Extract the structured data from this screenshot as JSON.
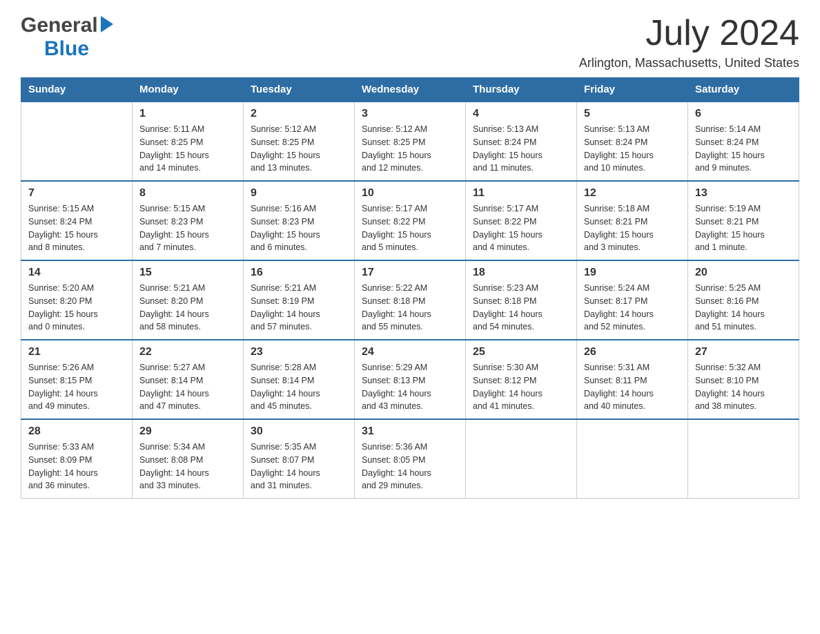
{
  "header": {
    "logo_general": "General",
    "logo_blue": "Blue",
    "month_year": "July 2024",
    "location": "Arlington, Massachusetts, United States"
  },
  "calendar": {
    "days_of_week": [
      "Sunday",
      "Monday",
      "Tuesday",
      "Wednesday",
      "Thursday",
      "Friday",
      "Saturday"
    ],
    "weeks": [
      [
        {
          "day": "",
          "info": ""
        },
        {
          "day": "1",
          "info": "Sunrise: 5:11 AM\nSunset: 8:25 PM\nDaylight: 15 hours\nand 14 minutes."
        },
        {
          "day": "2",
          "info": "Sunrise: 5:12 AM\nSunset: 8:25 PM\nDaylight: 15 hours\nand 13 minutes."
        },
        {
          "day": "3",
          "info": "Sunrise: 5:12 AM\nSunset: 8:25 PM\nDaylight: 15 hours\nand 12 minutes."
        },
        {
          "day": "4",
          "info": "Sunrise: 5:13 AM\nSunset: 8:24 PM\nDaylight: 15 hours\nand 11 minutes."
        },
        {
          "day": "5",
          "info": "Sunrise: 5:13 AM\nSunset: 8:24 PM\nDaylight: 15 hours\nand 10 minutes."
        },
        {
          "day": "6",
          "info": "Sunrise: 5:14 AM\nSunset: 8:24 PM\nDaylight: 15 hours\nand 9 minutes."
        }
      ],
      [
        {
          "day": "7",
          "info": "Sunrise: 5:15 AM\nSunset: 8:24 PM\nDaylight: 15 hours\nand 8 minutes."
        },
        {
          "day": "8",
          "info": "Sunrise: 5:15 AM\nSunset: 8:23 PM\nDaylight: 15 hours\nand 7 minutes."
        },
        {
          "day": "9",
          "info": "Sunrise: 5:16 AM\nSunset: 8:23 PM\nDaylight: 15 hours\nand 6 minutes."
        },
        {
          "day": "10",
          "info": "Sunrise: 5:17 AM\nSunset: 8:22 PM\nDaylight: 15 hours\nand 5 minutes."
        },
        {
          "day": "11",
          "info": "Sunrise: 5:17 AM\nSunset: 8:22 PM\nDaylight: 15 hours\nand 4 minutes."
        },
        {
          "day": "12",
          "info": "Sunrise: 5:18 AM\nSunset: 8:21 PM\nDaylight: 15 hours\nand 3 minutes."
        },
        {
          "day": "13",
          "info": "Sunrise: 5:19 AM\nSunset: 8:21 PM\nDaylight: 15 hours\nand 1 minute."
        }
      ],
      [
        {
          "day": "14",
          "info": "Sunrise: 5:20 AM\nSunset: 8:20 PM\nDaylight: 15 hours\nand 0 minutes."
        },
        {
          "day": "15",
          "info": "Sunrise: 5:21 AM\nSunset: 8:20 PM\nDaylight: 14 hours\nand 58 minutes."
        },
        {
          "day": "16",
          "info": "Sunrise: 5:21 AM\nSunset: 8:19 PM\nDaylight: 14 hours\nand 57 minutes."
        },
        {
          "day": "17",
          "info": "Sunrise: 5:22 AM\nSunset: 8:18 PM\nDaylight: 14 hours\nand 55 minutes."
        },
        {
          "day": "18",
          "info": "Sunrise: 5:23 AM\nSunset: 8:18 PM\nDaylight: 14 hours\nand 54 minutes."
        },
        {
          "day": "19",
          "info": "Sunrise: 5:24 AM\nSunset: 8:17 PM\nDaylight: 14 hours\nand 52 minutes."
        },
        {
          "day": "20",
          "info": "Sunrise: 5:25 AM\nSunset: 8:16 PM\nDaylight: 14 hours\nand 51 minutes."
        }
      ],
      [
        {
          "day": "21",
          "info": "Sunrise: 5:26 AM\nSunset: 8:15 PM\nDaylight: 14 hours\nand 49 minutes."
        },
        {
          "day": "22",
          "info": "Sunrise: 5:27 AM\nSunset: 8:14 PM\nDaylight: 14 hours\nand 47 minutes."
        },
        {
          "day": "23",
          "info": "Sunrise: 5:28 AM\nSunset: 8:14 PM\nDaylight: 14 hours\nand 45 minutes."
        },
        {
          "day": "24",
          "info": "Sunrise: 5:29 AM\nSunset: 8:13 PM\nDaylight: 14 hours\nand 43 minutes."
        },
        {
          "day": "25",
          "info": "Sunrise: 5:30 AM\nSunset: 8:12 PM\nDaylight: 14 hours\nand 41 minutes."
        },
        {
          "day": "26",
          "info": "Sunrise: 5:31 AM\nSunset: 8:11 PM\nDaylight: 14 hours\nand 40 minutes."
        },
        {
          "day": "27",
          "info": "Sunrise: 5:32 AM\nSunset: 8:10 PM\nDaylight: 14 hours\nand 38 minutes."
        }
      ],
      [
        {
          "day": "28",
          "info": "Sunrise: 5:33 AM\nSunset: 8:09 PM\nDaylight: 14 hours\nand 36 minutes."
        },
        {
          "day": "29",
          "info": "Sunrise: 5:34 AM\nSunset: 8:08 PM\nDaylight: 14 hours\nand 33 minutes."
        },
        {
          "day": "30",
          "info": "Sunrise: 5:35 AM\nSunset: 8:07 PM\nDaylight: 14 hours\nand 31 minutes."
        },
        {
          "day": "31",
          "info": "Sunrise: 5:36 AM\nSunset: 8:05 PM\nDaylight: 14 hours\nand 29 minutes."
        },
        {
          "day": "",
          "info": ""
        },
        {
          "day": "",
          "info": ""
        },
        {
          "day": "",
          "info": ""
        }
      ]
    ]
  }
}
